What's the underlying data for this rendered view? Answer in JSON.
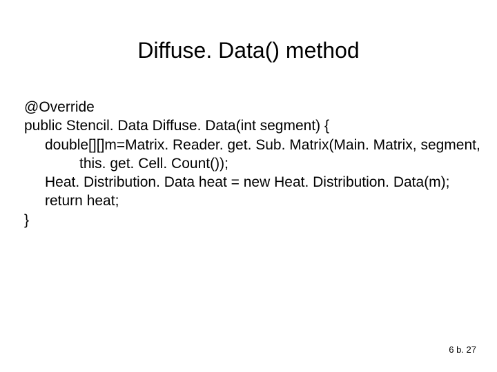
{
  "slide": {
    "title": "Diffuse. Data() method",
    "code": {
      "line1": "@Override",
      "line2": "public Stencil. Data Diffuse. Data(int segment) {",
      "line3": "double[][]m=Matrix. Reader. get. Sub. Matrix(Main. Matrix, segment,",
      "line4": "this. get. Cell. Count());",
      "line5": "Heat. Distribution. Data heat = new Heat. Distribution. Data(m);",
      "line6": "return heat;",
      "line7": "}"
    },
    "page_number": "6 b. 27"
  }
}
